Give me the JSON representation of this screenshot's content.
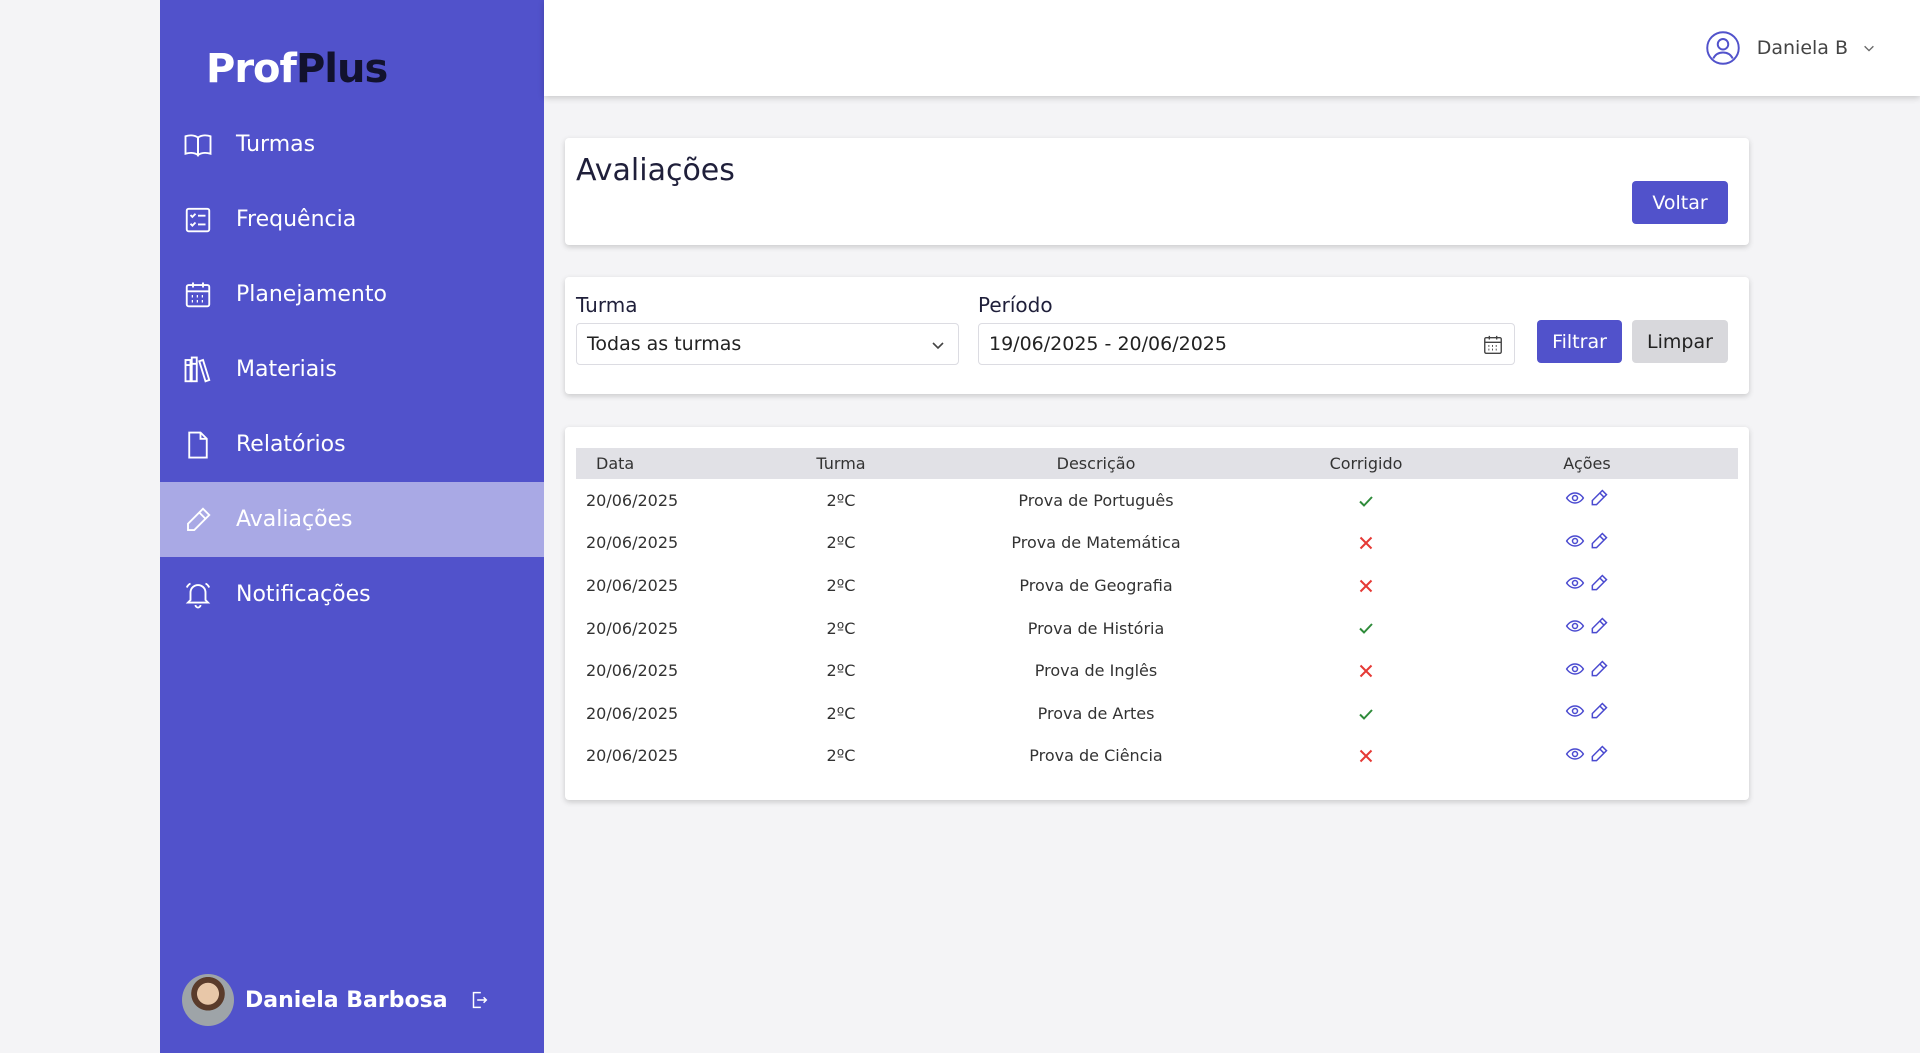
{
  "brand": {
    "part1": "Prof",
    "part2": "Plus"
  },
  "sidebar": {
    "items": [
      {
        "label": "Turmas",
        "icon": "book-open-icon"
      },
      {
        "label": "Frequência",
        "icon": "checklist-icon"
      },
      {
        "label": "Planejamento",
        "icon": "calendar-icon"
      },
      {
        "label": "Materiais",
        "icon": "library-icon"
      },
      {
        "label": "Relatórios",
        "icon": "file-icon"
      },
      {
        "label": "Avaliações",
        "icon": "pencil-icon",
        "active": true
      },
      {
        "label": "Notificações",
        "icon": "bell-icon"
      }
    ],
    "user_name": "Daniela Barbosa"
  },
  "topbar": {
    "user_name": "Daniela B"
  },
  "page": {
    "title": "Avaliações",
    "back_label": "Voltar"
  },
  "filter": {
    "turma_label": "Turma",
    "turma_value": "Todas as turmas",
    "periodo_label": "Período",
    "periodo_value": "19/06/2025 - 20/06/2025",
    "filter_label": "Filtrar",
    "clear_label": "Limpar"
  },
  "table": {
    "headers": [
      "Data",
      "Turma",
      "Descrição",
      "Corrigido",
      "Ações"
    ],
    "rows": [
      {
        "data": "20/06/2025",
        "turma": "2ºC",
        "descricao": "Prova de Português",
        "corrigido": true
      },
      {
        "data": "20/06/2025",
        "turma": "2ºC",
        "descricao": "Prova de Matemática",
        "corrigido": false
      },
      {
        "data": "20/06/2025",
        "turma": "2ºC",
        "descricao": "Prova de Geografia",
        "corrigido": false
      },
      {
        "data": "20/06/2025",
        "turma": "2ºC",
        "descricao": "Prova de História",
        "corrigido": true
      },
      {
        "data": "20/06/2025",
        "turma": "2ºC",
        "descricao": "Prova de Inglês",
        "corrigido": false
      },
      {
        "data": "20/06/2025",
        "turma": "2ºC",
        "descricao": "Prova de Artes",
        "corrigido": true
      },
      {
        "data": "20/06/2025",
        "turma": "2ºC",
        "descricao": "Prova de Ciência",
        "corrigido": false
      }
    ]
  },
  "colors": {
    "primary": "#5152cb",
    "sidebar_active": "#a9a9e5",
    "check": "#2e8b3a",
    "cross": "#e53935",
    "action_icon": "#4a4ad0"
  }
}
